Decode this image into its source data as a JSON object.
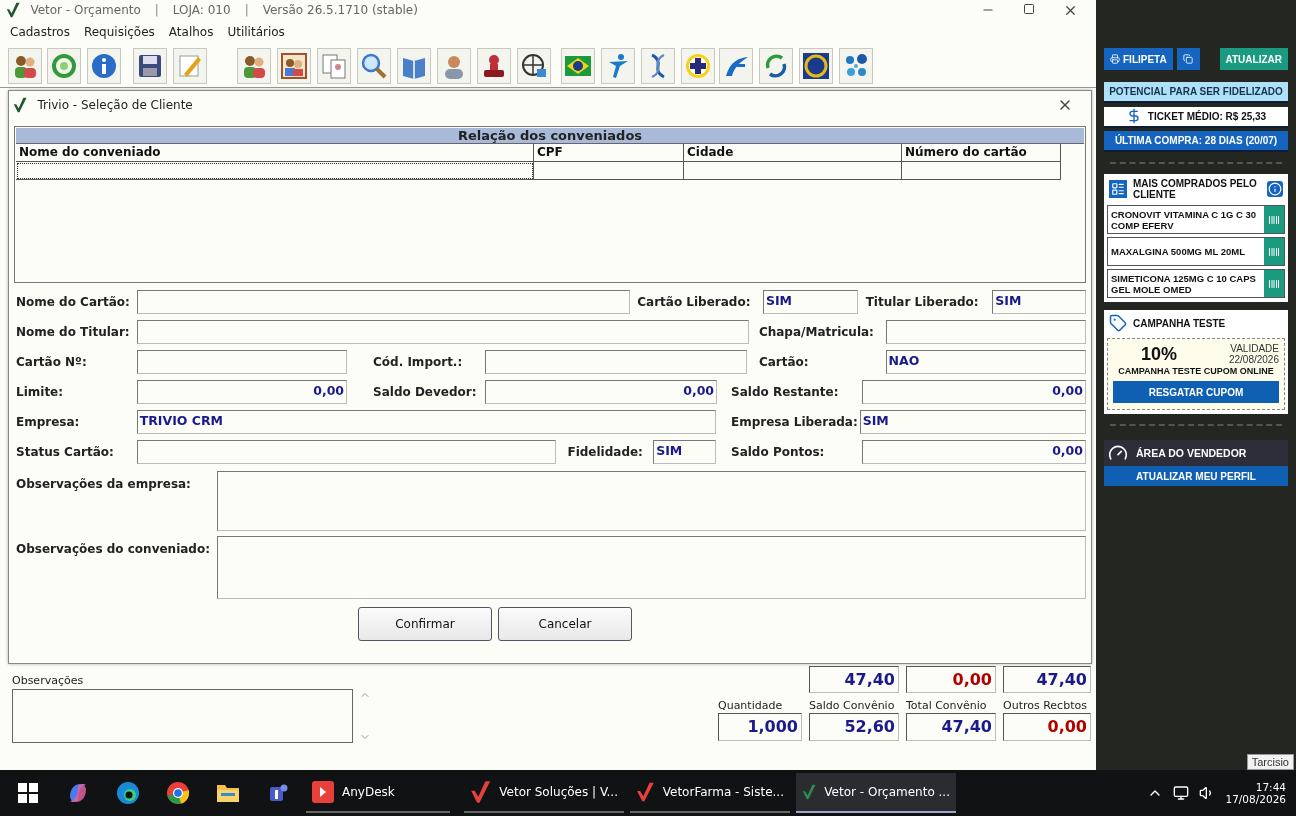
{
  "window": {
    "title_bar": [
      {
        "kind": "text",
        "text": "Vetor - Orçamento"
      },
      {
        "kind": "separator",
        "text": "|"
      },
      {
        "kind": "text",
        "text": "LOJA: 010"
      },
      {
        "kind": "separator",
        "text": "|"
      },
      {
        "kind": "text",
        "text": "Versão 26.5.1710 (stable)"
      }
    ]
  },
  "menu": [
    "Cadastros",
    "Requisições",
    "Atalhos",
    "Utilitários"
  ],
  "dialog": {
    "title": "Trivio - Seleção de Cliente",
    "table": {
      "title": "Relação dos conveniados",
      "columns": [
        "Nome do conveniado",
        "CPF",
        "Cidade",
        "Número do cartão"
      ]
    },
    "form_rows": [
      [
        {
          "kind": "label",
          "text": "Nome do Cartão:"
        },
        {
          "kind": "field"
        },
        {
          "kind": "label",
          "text": "Cartão Liberado:"
        },
        {
          "kind": "field",
          "value": "SIM"
        },
        {
          "kind": "label",
          "text": "Titular Liberado:"
        },
        {
          "kind": "field",
          "value": "SIM"
        }
      ],
      [
        {
          "kind": "label",
          "text": "Nome do Titular:"
        },
        {
          "kind": "field"
        },
        {
          "kind": "label",
          "text": "Chapa/Matricula:"
        },
        {
          "kind": "field"
        }
      ],
      [
        {
          "kind": "label",
          "text": "Cartão Nº:"
        },
        {
          "kind": "field"
        },
        {
          "kind": "label",
          "text": "Cód. Import.:"
        },
        {
          "kind": "field"
        },
        {
          "kind": "label",
          "text": "Cartão:"
        },
        {
          "kind": "field",
          "value": "NAO"
        }
      ],
      [
        {
          "kind": "label",
          "text": "Limite:"
        },
        {
          "kind": "number",
          "value": "0,00"
        },
        {
          "kind": "label",
          "text": "Saldo Devedor:"
        },
        {
          "kind": "number",
          "value": "0,00"
        },
        {
          "kind": "label",
          "text": "Saldo Restante:"
        },
        {
          "kind": "number",
          "value": "0,00"
        }
      ],
      [
        {
          "kind": "label",
          "text": "Empresa:"
        },
        {
          "kind": "field",
          "value": "TRIVIO CRM"
        },
        {
          "kind": "label",
          "text": "Empresa Liberada:"
        },
        {
          "kind": "field",
          "value": "SIM"
        }
      ],
      [
        {
          "kind": "label",
          "text": "Status Cartão:"
        },
        {
          "kind": "field"
        },
        {
          "kind": "label",
          "text": "Fidelidade:"
        },
        {
          "kind": "field",
          "value": "SIM"
        },
        {
          "kind": "label",
          "text": "Saldo Pontos:"
        },
        {
          "kind": "number",
          "value": "0,00"
        }
      ]
    ],
    "observations": [
      "Observações da empresa:",
      "Observações do conveniado:"
    ],
    "buttons": [
      "Confirmar",
      "Cancelar"
    ]
  },
  "bottom": {
    "notes_label": "Observações",
    "totals_top": [
      {
        "value": "47,40",
        "color": "#1a1a8c"
      },
      {
        "value": "0,00",
        "color": "#b00000"
      },
      {
        "value": "47,40",
        "color": "#1a1a8c"
      }
    ],
    "totals": [
      {
        "label": "Quantidade",
        "value": "1,000",
        "color": "#1a1a8c"
      },
      {
        "label": "Saldo Convênio",
        "value": "52,60",
        "color": "#1a1a8c"
      },
      {
        "label": "Total Convênio",
        "value": "47,40",
        "color": "#1a1a8c"
      },
      {
        "label": "Outros Recbtos",
        "value": "0,00",
        "color": "#b00000"
      }
    ]
  },
  "side_panel": {
    "print_button": "FILIPETA",
    "refresh_button": "ATUALIZAR",
    "potential": "POTENCIAL PARA SER FIDELIZADO",
    "ticket": "TICKET MÉDIO: R$ 25,33",
    "last_purchase": "ÚLTIMA COMPRA: 28 DIAS (20/07)",
    "top_products": {
      "title": "MAIS COMPRADOS PELO CLIENTE",
      "items": [
        "CRONOVIT VITAMINA C 1G C 30 COMP EFERV",
        "MAXALGINA 500MG ML 20ML",
        "SIMETICONA 125MG C 10 CAPS GEL MOLE OMED"
      ]
    },
    "campaign": {
      "title": "CAMPANHA TESTE",
      "discount": "10%",
      "validity_label": "VALIDADE",
      "validity_date": "22/08/2026",
      "name": "CAMPANHA TESTE CUPOM ONLINE",
      "button": "RESGATAR CUPOM"
    },
    "seller": {
      "title": "ÁREA DO VENDEDOR",
      "button": "ATUALIZAR MEU PERFIL"
    }
  },
  "tooltip": "Tarcisio",
  "taskbar": {
    "apps": [
      {
        "kind": "anydesk",
        "label": "AnyDesk",
        "selected": false
      },
      {
        "kind": "vetor-red",
        "label": "Vetor Soluções  |  V...",
        "selected": false
      },
      {
        "kind": "vetor-red",
        "label": "VetorFarma - Siste...",
        "selected": false
      },
      {
        "kind": "vetor-green",
        "label": "Vetor - Orçamento ...",
        "selected": true
      }
    ],
    "time": "17:44",
    "date": "17/08/2026"
  }
}
